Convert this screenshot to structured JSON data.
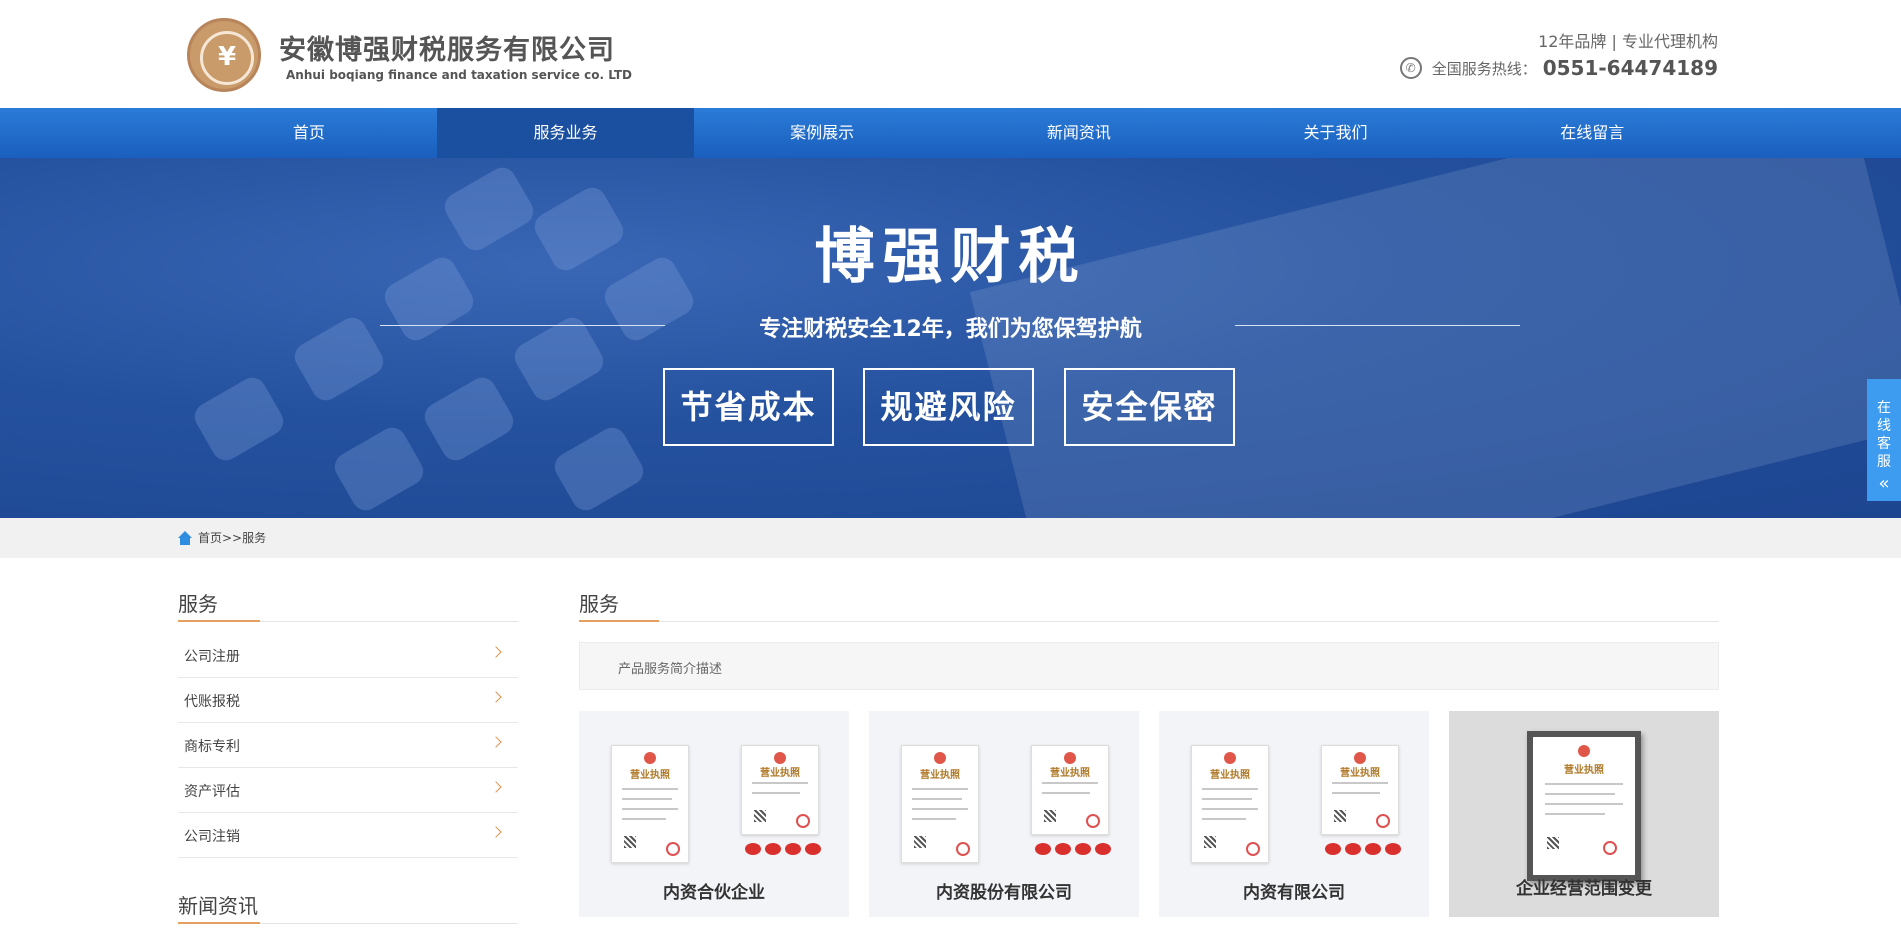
{
  "header": {
    "company_cn": "安徽博强财税服务有限公司",
    "company_en": "Anhui boqiang finance and taxation service co. LTD",
    "tagline": "12年品牌 | 专业代理机构",
    "hotline_label": "全国服务热线：",
    "hotline_number": "0551-64474189",
    "logo_icon": "company-logo",
    "phone_icon": "phone-icon"
  },
  "nav": {
    "items": [
      {
        "label": "首页"
      },
      {
        "label": "服务业务",
        "active": true
      },
      {
        "label": "案例展示"
      },
      {
        "label": "新闻资讯"
      },
      {
        "label": "关于我们"
      },
      {
        "label": "在线留言"
      }
    ]
  },
  "banner": {
    "title": "博强财税",
    "subtitle": "专注财税安全12年，我们为您保驾护航",
    "boxes": [
      "节省成本",
      "规避风险",
      "安全保密"
    ]
  },
  "float_service": {
    "label": "在线客服",
    "icon": "double-chevron-left-icon"
  },
  "breadcrumb": {
    "text": "首页>>服务",
    "icon": "home-icon"
  },
  "sidebar": {
    "title": "服务",
    "items": [
      {
        "label": "公司注册"
      },
      {
        "label": "代账报税"
      },
      {
        "label": "商标专利"
      },
      {
        "label": "资产评估"
      },
      {
        "label": "公司注销"
      }
    ],
    "news_title": "新闻资讯"
  },
  "main": {
    "title": "服务",
    "description": "产品服务简介描述",
    "cards": [
      {
        "label": "内资合伙企业"
      },
      {
        "label": "内资股份有限公司"
      },
      {
        "label": "内资有限公司"
      },
      {
        "label": "企业经营范围变更"
      }
    ]
  },
  "colors": {
    "nav_blue": "#2b7bd8",
    "nav_active": "#1b4f9f",
    "accent_orange": "#e4a15e",
    "float_blue": "#3d9cf0"
  }
}
